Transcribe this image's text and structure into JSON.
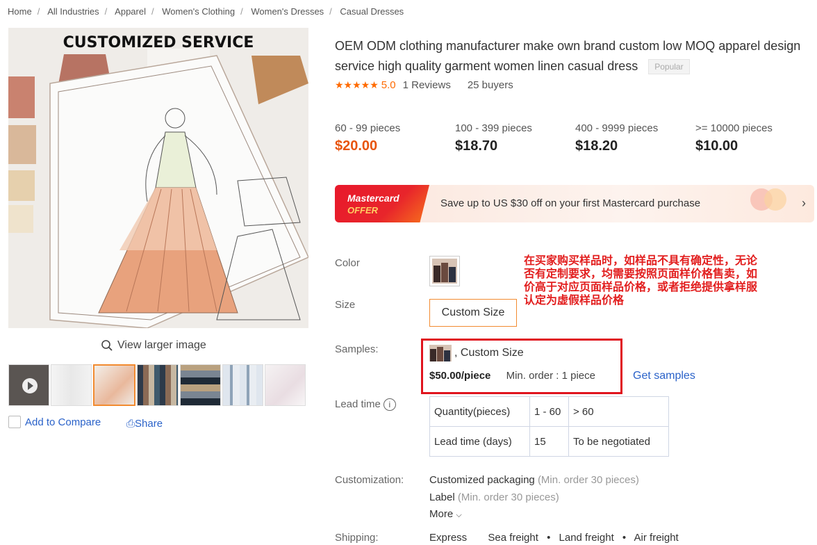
{
  "breadcrumb": [
    "Home",
    "All Industries",
    "Apparel",
    "Women's Clothing",
    "Women's Dresses",
    "Casual Dresses"
  ],
  "gallery": {
    "banner_text": "CUSTOMIZED SERVICE",
    "view_larger": "View larger image",
    "add_to_compare": "Add to Compare",
    "share": "Share"
  },
  "product": {
    "title": "OEM ODM clothing manufacturer make own brand custom low MOQ apparel design service high quality garment women linen casual dress",
    "badge": "Popular",
    "rating": "5.0",
    "reviews": "1 Reviews",
    "buyers": "25 buyers",
    "tiers": [
      {
        "qty": "60 - 99 pieces",
        "price": "$20.00"
      },
      {
        "qty": "100 - 399 pieces",
        "price": "$18.70"
      },
      {
        "qty": "400 - 9999 pieces",
        "price": "$18.20"
      },
      {
        "qty": ">= 10000 pieces",
        "price": "$10.00"
      }
    ]
  },
  "promo": {
    "badge_line1": "Mastercard",
    "badge_line2": "OFFER",
    "text": "Save up to US $30 off on your first Mastercard purchase"
  },
  "options": {
    "color_label": "Color",
    "size_label": "Size",
    "size_value": "Custom Size",
    "samples_label": "Samples:",
    "sample_desc": ", Custom Size",
    "sample_price": "$50.00/piece",
    "sample_moq": "Min. order : 1 piece",
    "get_samples": "Get samples",
    "lead_time_label": "Lead time",
    "lead_table": [
      [
        "Quantity(pieces)",
        "1 - 60",
        "> 60"
      ],
      [
        "Lead time (days)",
        "15",
        "To be negotiated"
      ]
    ],
    "customization_label": "Customization:",
    "custom1": "Customized packaging",
    "custom1_note": "(Min. order 30 pieces)",
    "custom2": "Label",
    "custom2_note": "(Min. order 30 pieces)",
    "more": "More",
    "shipping_label": "Shipping:",
    "shipping_methods": [
      "Express",
      "Sea freight",
      "Land freight",
      "Air freight"
    ]
  },
  "notice": {
    "lines": [
      "在买家购买样品时，如样品不具有确定性，无论",
      "否有定制要求，均需要按照页面样价格售卖，如",
      "价高于对应页面样品价格，或者拒绝提供拿样服",
      "认定为虚假样品价格"
    ]
  }
}
